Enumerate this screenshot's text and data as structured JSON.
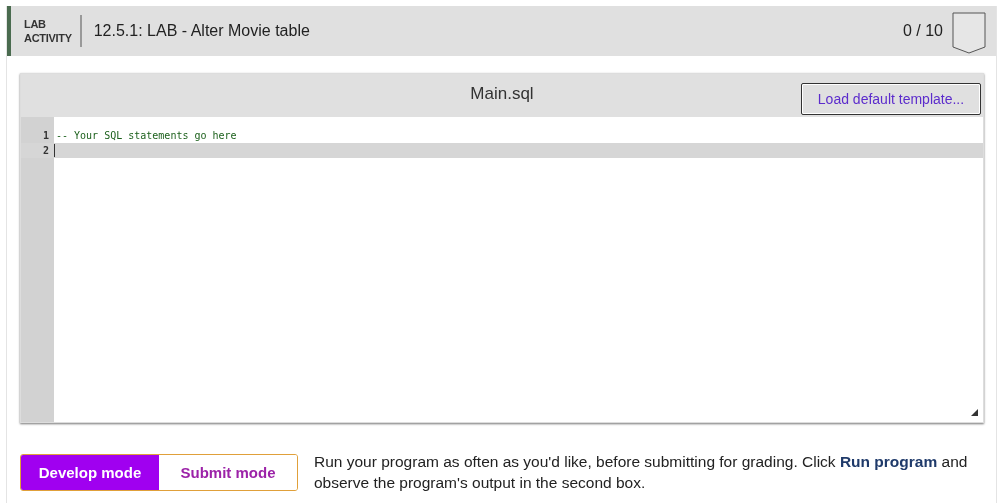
{
  "header": {
    "badge_line_1": "LAB",
    "badge_line_2": "ACTIVITY",
    "title": "12.5.1: LAB - Alter Movie table",
    "score": "0 / 10"
  },
  "editor": {
    "filename": "Main.sql",
    "load_button": "Load default template...",
    "lines": [
      {
        "number": "1",
        "text": "-- Your SQL statements go here",
        "active": false
      },
      {
        "number": "2",
        "active": true
      }
    ]
  },
  "modes": [
    {
      "label": "Develop mode",
      "selected": true
    },
    {
      "label": "Submit mode",
      "selected": false
    }
  ],
  "instructions": "Run your program as often as you'd like, before submitting for grading. Click **Run program** and observe the program's output in the second box."
}
